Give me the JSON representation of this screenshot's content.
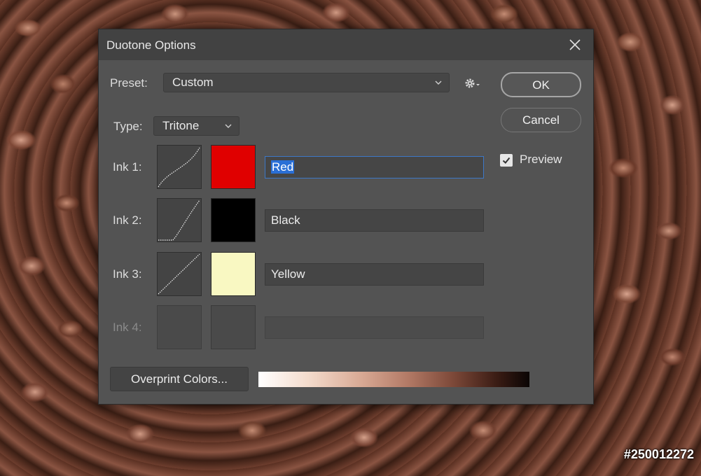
{
  "dialog": {
    "title": "Duotone Options",
    "preset_label": "Preset:",
    "preset_value": "Custom",
    "type_label": "Type:",
    "type_value": "Tritone",
    "ok_label": "OK",
    "cancel_label": "Cancel",
    "preview_label": "Preview",
    "preview_checked": true,
    "overprint_label": "Overprint Colors...",
    "inks": [
      {
        "label": "Ink 1:",
        "name": "Red",
        "color": "#e00000",
        "enabled": true
      },
      {
        "label": "Ink 2:",
        "name": "Black",
        "color": "#000000",
        "enabled": true
      },
      {
        "label": "Ink 3:",
        "name": "Yellow",
        "color": "#f9f8c2",
        "enabled": true
      },
      {
        "label": "Ink 4:",
        "name": "",
        "color": "#4a4a4a",
        "enabled": false
      }
    ]
  },
  "watermark": "#250012272",
  "colors": {
    "dialog_bg": "#535353",
    "titlebar_bg": "#424242",
    "selection": "#2a6fd6"
  },
  "icons": [
    "close-icon",
    "chevron-down-icon",
    "gear-icon",
    "checkmark-icon"
  ]
}
